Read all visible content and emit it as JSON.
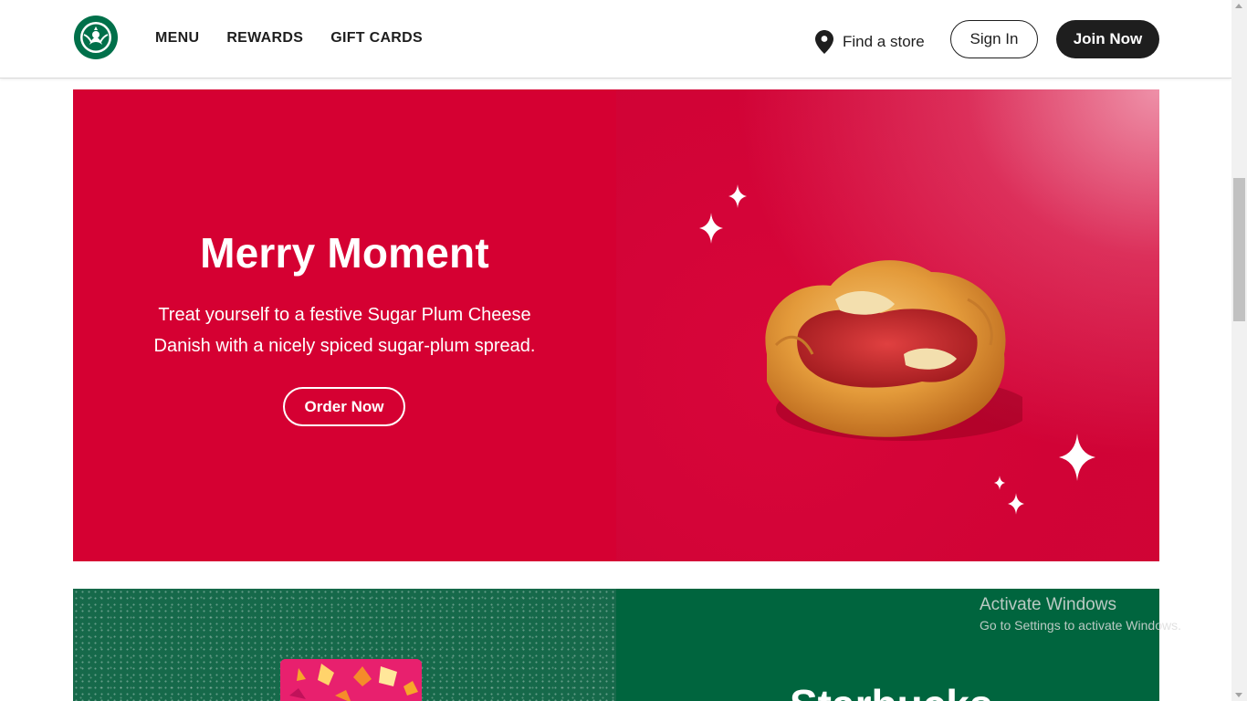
{
  "header": {
    "nav": [
      "MENU",
      "REWARDS",
      "GIFT CARDS"
    ],
    "find_store": "Find a store",
    "sign_in": "Sign In",
    "join_now": "Join Now"
  },
  "hero": {
    "title": "Merry Moment",
    "text": "Treat yourself to a festive Sugar Plum Cheese Danish with a nicely spiced sugar-plum spread.",
    "cta": "Order Now"
  },
  "section2": {
    "title_partial": "Starbucks"
  },
  "watermark": {
    "title": "Activate Windows",
    "subtitle": "Go to Settings to activate Windows."
  },
  "colors": {
    "hero_red": "#d50032",
    "starbucks_green": "#00704a",
    "dark_green": "#00653e",
    "black": "#1e1e1e"
  },
  "icons": {
    "logo": "starbucks-siren-logo",
    "store": "location-pin-icon"
  }
}
